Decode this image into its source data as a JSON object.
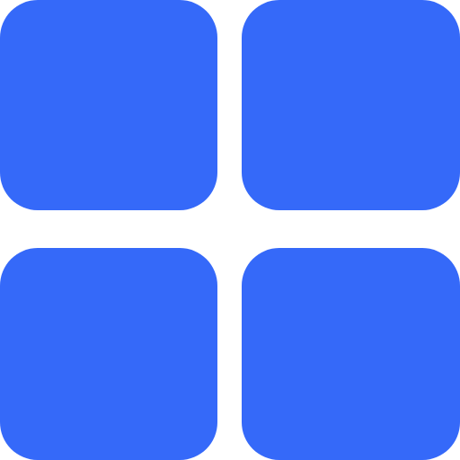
{
  "icon": {
    "name": "grid-icon",
    "color": "#3569F9",
    "tiles": [
      "top-left",
      "top-right",
      "bottom-left",
      "bottom-right"
    ]
  }
}
